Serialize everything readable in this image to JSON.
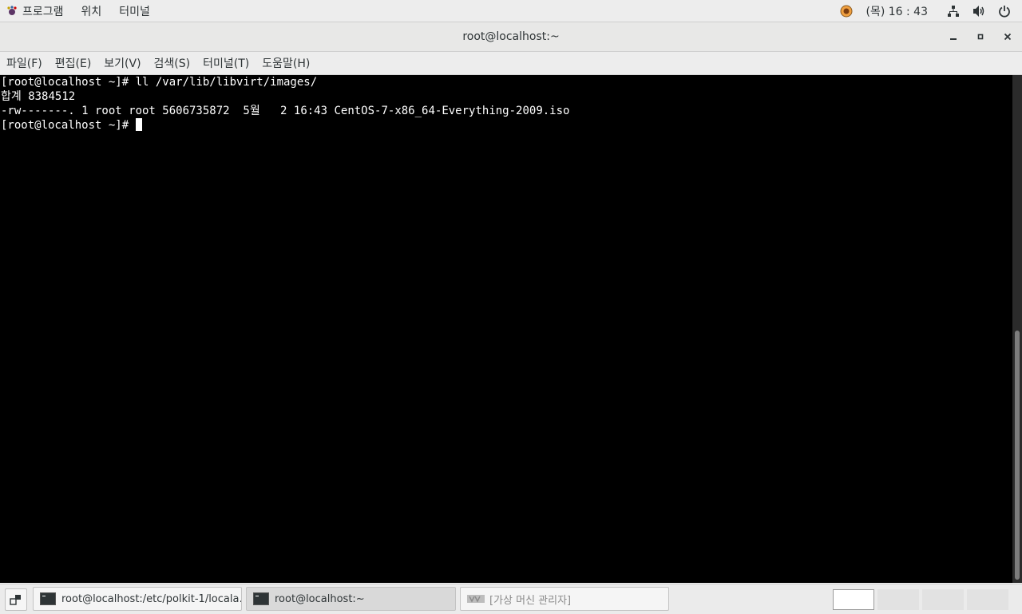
{
  "top_panel": {
    "apps_menu": "프로그램",
    "places_menu": "위치",
    "terminal_menu": "터미널",
    "clock": "(목) 16 : 43"
  },
  "window": {
    "title": "root@localhost:~",
    "minimize": "–",
    "maximize": "▫",
    "close": "✕"
  },
  "menubar": {
    "items": [
      "파일(F)",
      "편집(E)",
      "보기(V)",
      "검색(S)",
      "터미널(T)",
      "도움말(H)"
    ]
  },
  "terminal": {
    "lines": [
      "[root@localhost ~]# ll /var/lib/libvirt/images/",
      "합계 8384512",
      "-rw-------. 1 root root 5606735872  5월   2 16:43 CentOS-7-x86_64-Everything-2009.iso"
    ],
    "prompt": "[root@localhost ~]# "
  },
  "taskbar": {
    "tasks": [
      {
        "label": "root@localhost:/etc/polkit-1/locala…"
      },
      {
        "label": "root@localhost:~"
      },
      {
        "label": "[가상 머신 관리자]"
      }
    ]
  },
  "colors": {
    "terminal_bg": "#000000",
    "terminal_fg": "#ffffff",
    "panel_bg": "#ededed"
  }
}
